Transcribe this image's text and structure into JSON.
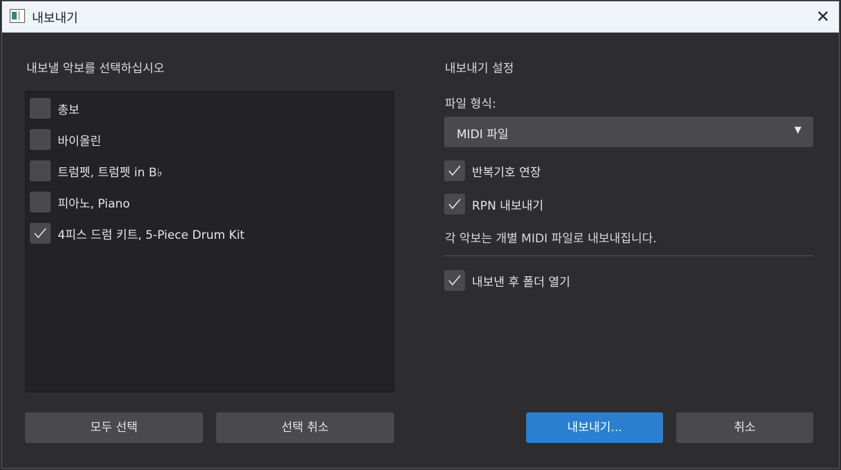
{
  "window": {
    "title": "내보내기"
  },
  "left_panel": {
    "heading": "내보낼 악보를 선택하십시오",
    "scores": [
      {
        "label": "총보",
        "checked": false
      },
      {
        "label": "바이올린",
        "checked": false
      },
      {
        "label": "트럼펫, 트럼펫 in B♭",
        "checked": false
      },
      {
        "label": "피아노, Piano",
        "checked": false
      },
      {
        "label": "4피스 드럼 키트, 5-Piece Drum Kit",
        "checked": true
      }
    ],
    "select_all_label": "모두 선택",
    "deselect_label": "선택 취소"
  },
  "right_panel": {
    "heading": "내보내기 설정",
    "file_format_label": "파일 형식:",
    "file_format_value": "MIDI 파일",
    "options": [
      {
        "label": "반복기호 연장",
        "checked": true
      },
      {
        "label": "RPN 내보내기",
        "checked": true
      }
    ],
    "info": "각 악보는 개별 MIDI 파일로 내보내집니다.",
    "open_folder": {
      "label": "내보낸 후 폴더 열기",
      "checked": true
    },
    "export_label": "내보내기...",
    "cancel_label": "취소"
  },
  "icons": {
    "close": "close-icon",
    "check": "checkmark-icon",
    "dropdown": "dropdown-arrow-icon"
  },
  "colors": {
    "primary": "#2a7fd0",
    "background": "#2d2d30",
    "control": "#4a4a4d"
  }
}
